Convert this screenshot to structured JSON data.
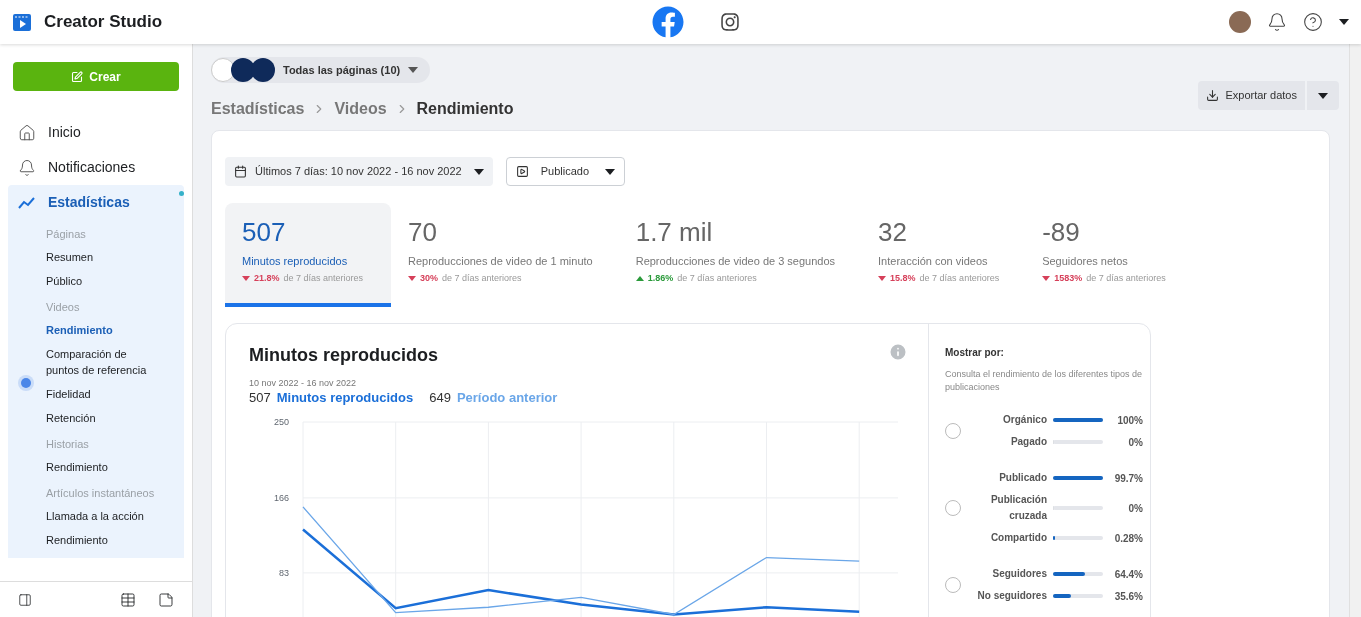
{
  "app": {
    "title": "Creator Studio"
  },
  "platforms": [
    {
      "kind": "facebook",
      "selected": true
    },
    {
      "kind": "instagram",
      "selected": false
    }
  ],
  "create_button": "Crear",
  "nav": [
    {
      "label": "Inicio",
      "kind": "home",
      "selected": false
    },
    {
      "label": "Notificaciones",
      "kind": "bell",
      "selected": false
    },
    {
      "label": "Estadísticas",
      "kind": "stats",
      "selected": true,
      "expanded": true,
      "badge": true
    }
  ],
  "nav_sections": [
    {
      "heading": "Páginas",
      "items": [
        {
          "label": "Resumen",
          "selected": false
        },
        {
          "label": "Público",
          "selected": false
        }
      ]
    },
    {
      "heading": "Videos",
      "items": [
        {
          "label": "Rendimiento",
          "selected": true
        },
        {
          "label": "Comparación de puntos de referencia",
          "selected": false
        },
        {
          "label": "Fidelidad",
          "selected": false,
          "dot": true
        },
        {
          "label": "Retención",
          "selected": false
        }
      ]
    },
    {
      "heading": "Historias",
      "items": [
        {
          "label": "Rendimiento",
          "selected": false
        }
      ]
    },
    {
      "heading": "Artículos instantáneos",
      "items": [
        {
          "label": "Llamada a la acción",
          "selected": false
        },
        {
          "label": "Rendimiento",
          "selected": false
        }
      ]
    }
  ],
  "page_selector": {
    "label": "Todas las páginas (10)"
  },
  "breadcrumb": [
    {
      "label": "Estadísticas",
      "current": false
    },
    {
      "label": "Videos",
      "current": false
    },
    {
      "label": "Rendimiento",
      "current": true
    }
  ],
  "export_button": "Exportar datos",
  "date_filter": "Últimos 7 días: 10 nov 2022 - 16 nov 2022",
  "type_filter": "Publicado",
  "metrics": [
    {
      "value": "507",
      "label": "Minutos reproducidos",
      "change": "21.8%",
      "kind": "decrease",
      "note": "de 7 días anteriores",
      "selected": true
    },
    {
      "value": "70",
      "label": "Reproducciones de video de 1 minuto",
      "change": "30%",
      "kind": "decrease",
      "note": "de 7 días anteriores",
      "selected": false
    },
    {
      "value": "1.7 mil",
      "label": "Reproducciones de video de 3 segundos",
      "change": "1.86%",
      "kind": "increase",
      "note": "de 7 días anteriores",
      "selected": false
    },
    {
      "value": "32",
      "label": "Interacción con videos",
      "change": "15.8%",
      "kind": "decrease",
      "note": "de 7 días anteriores",
      "selected": false
    },
    {
      "value": "-89",
      "label": "Seguidores netos",
      "change": "1583%",
      "kind": "decrease",
      "note": "de 7 días anteriores",
      "selected": false
    }
  ],
  "chart_card": {
    "title": "Minutos reproducidos",
    "range": "10 nov 2022 - 16 nov 2022",
    "legend": [
      {
        "value": "507"
      },
      {
        "value": "649"
      }
    ],
    "chart_data": {
      "type": "line",
      "yticks": [
        83,
        166,
        250
      ],
      "ylim": [
        0,
        250
      ],
      "grid": true,
      "series": [
        {
          "name": "Minutos reproducidos",
          "color": "#1b6fd8",
          "values": [
            131,
            44,
            64,
            48,
            37,
            45,
            40
          ]
        },
        {
          "name": "Período anterior",
          "color": "#6aa6e8",
          "values": [
            156,
            39,
            45,
            56,
            37,
            100,
            96
          ]
        }
      ]
    }
  },
  "breakdown": {
    "title": "Mostrar por:",
    "description": "Consulta el rendimiento de los diferentes tipos de publicaciones",
    "groups": [
      {
        "selected": false,
        "rows": [
          {
            "label": "Orgánico",
            "level": 1,
            "reading": "100%"
          },
          {
            "label": "Pagado",
            "level": 0,
            "reading": "0%"
          }
        ]
      },
      {
        "selected": false,
        "rows": [
          {
            "label": "Publicado",
            "level": 0.997,
            "reading": "99.7%"
          },
          {
            "label": "Publicación cruzada",
            "level": 0,
            "reading": "0%"
          },
          {
            "label": "Compartido",
            "level": 0.0028,
            "reading": "0.28%"
          }
        ]
      },
      {
        "selected": false,
        "rows": [
          {
            "label": "Seguidores",
            "level": 0.644,
            "reading": "64.4%"
          },
          {
            "label": "No seguidores",
            "level": 0.356,
            "reading": "35.6%"
          }
        ]
      }
    ]
  }
}
